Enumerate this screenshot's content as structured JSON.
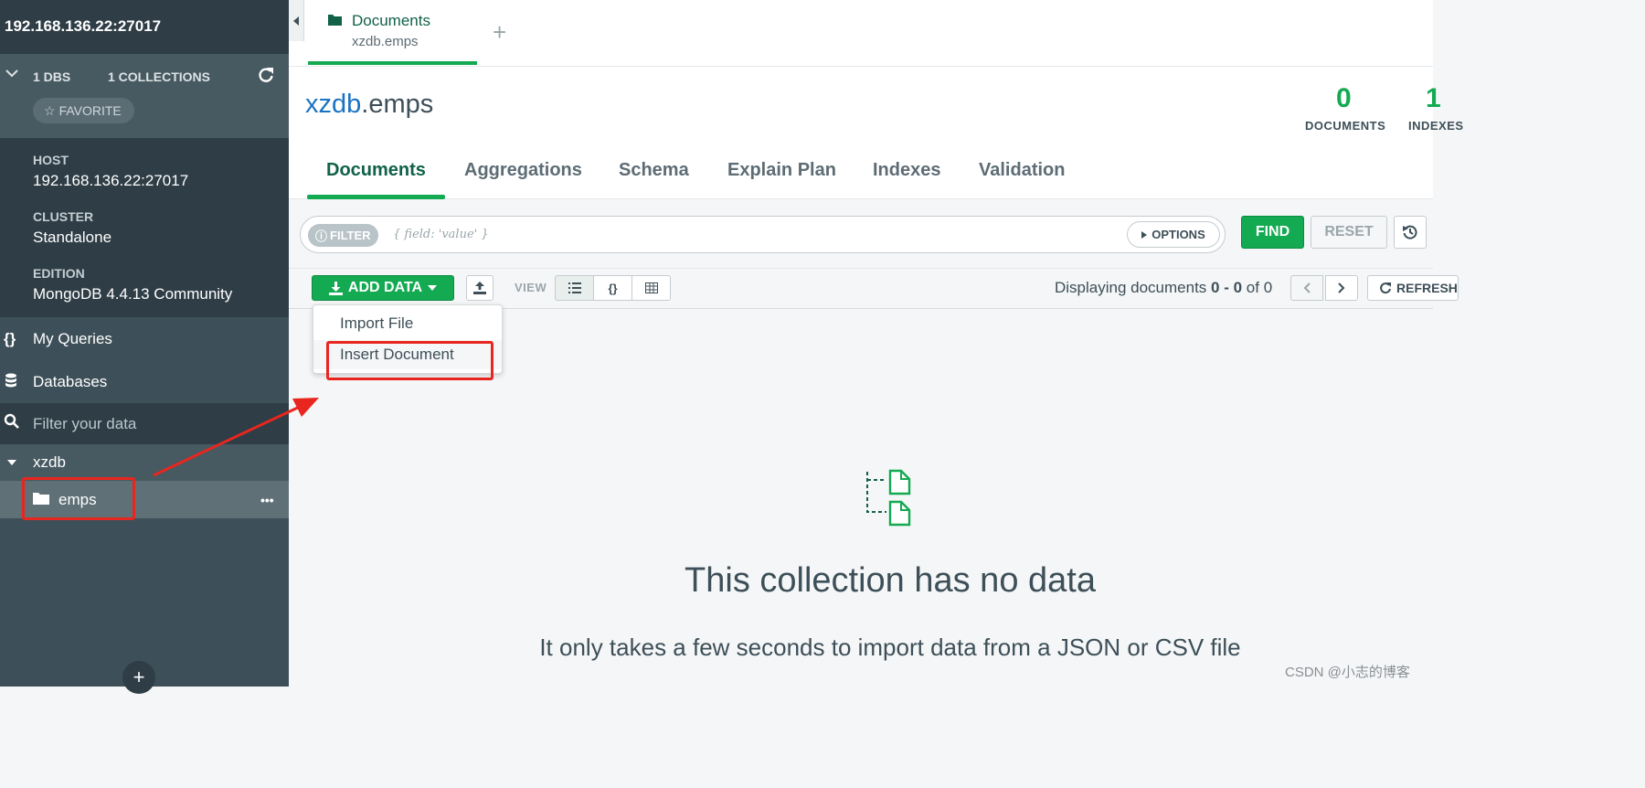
{
  "sidebar": {
    "title": "192.168.136.22:27017",
    "dbs_count": "1 DBS",
    "collections_count": "1 COLLECTIONS",
    "favorite_label": "FAVORITE",
    "host_label": "HOST",
    "host_value": "192.168.136.22:27017",
    "cluster_label": "CLUSTER",
    "cluster_value": "Standalone",
    "edition_label": "EDITION",
    "edition_value": "MongoDB 4.4.13 Community",
    "nav_queries_icon": "{}",
    "nav_queries": "My Queries",
    "nav_databases": "Databases",
    "filter_placeholder": "Filter your data",
    "database_name": "xzdb",
    "collection_name": "emps",
    "collection_menu": "•••",
    "add_button": "+"
  },
  "tab": {
    "title": "Documents",
    "subtitle": "xzdb.emps",
    "new_tab": "+"
  },
  "collection": {
    "db": "xzdb",
    "name": ".emps",
    "documents_count": "0",
    "documents_label": "DOCUMENTS",
    "indexes_count": "1",
    "indexes_label": "INDEXES"
  },
  "subtabs": [
    "Documents",
    "Aggregations",
    "Schema",
    "Explain Plan",
    "Indexes",
    "Validation"
  ],
  "query": {
    "filter_badge": "FILTER",
    "placeholder": "{ field: 'value' }",
    "options": "OPTIONS",
    "find": "FIND",
    "reset": "RESET"
  },
  "toolbar": {
    "add_data": "ADD DATA",
    "view_label": "VIEW",
    "json_view": "{}",
    "displaying_prefix": "Displaying documents ",
    "range": "0 - 0",
    "of_text": " of ",
    "total": "0",
    "refresh": "REFRESH"
  },
  "dropdown": {
    "items": [
      "Import File",
      "Insert Document"
    ]
  },
  "empty": {
    "title": "This collection has no data",
    "subtitle": "It only takes a few seconds to import data from a JSON or CSV file"
  },
  "watermark": "CSDN @小志的博客",
  "colors": {
    "accent_green": "#13aa52",
    "dark_green": "#116149",
    "sidebar": "#3d4f58",
    "sidebar_dark": "#2e3d46",
    "link_blue": "#1a73c2",
    "annotation_red": "#e8261f"
  },
  "icons": [
    "chevron-down-icon",
    "refresh-icon",
    "star-icon",
    "code-braces-icon",
    "database-icon",
    "search-icon",
    "caret-down-icon",
    "folder-icon",
    "ellipsis-icon",
    "plus-icon",
    "collapse-left-icon",
    "info-icon",
    "caret-right-icon",
    "history-icon",
    "download-icon",
    "upload-icon",
    "list-icon",
    "table-icon",
    "chevron-left-icon",
    "chevron-right-icon",
    "empty-documents-icon"
  ]
}
